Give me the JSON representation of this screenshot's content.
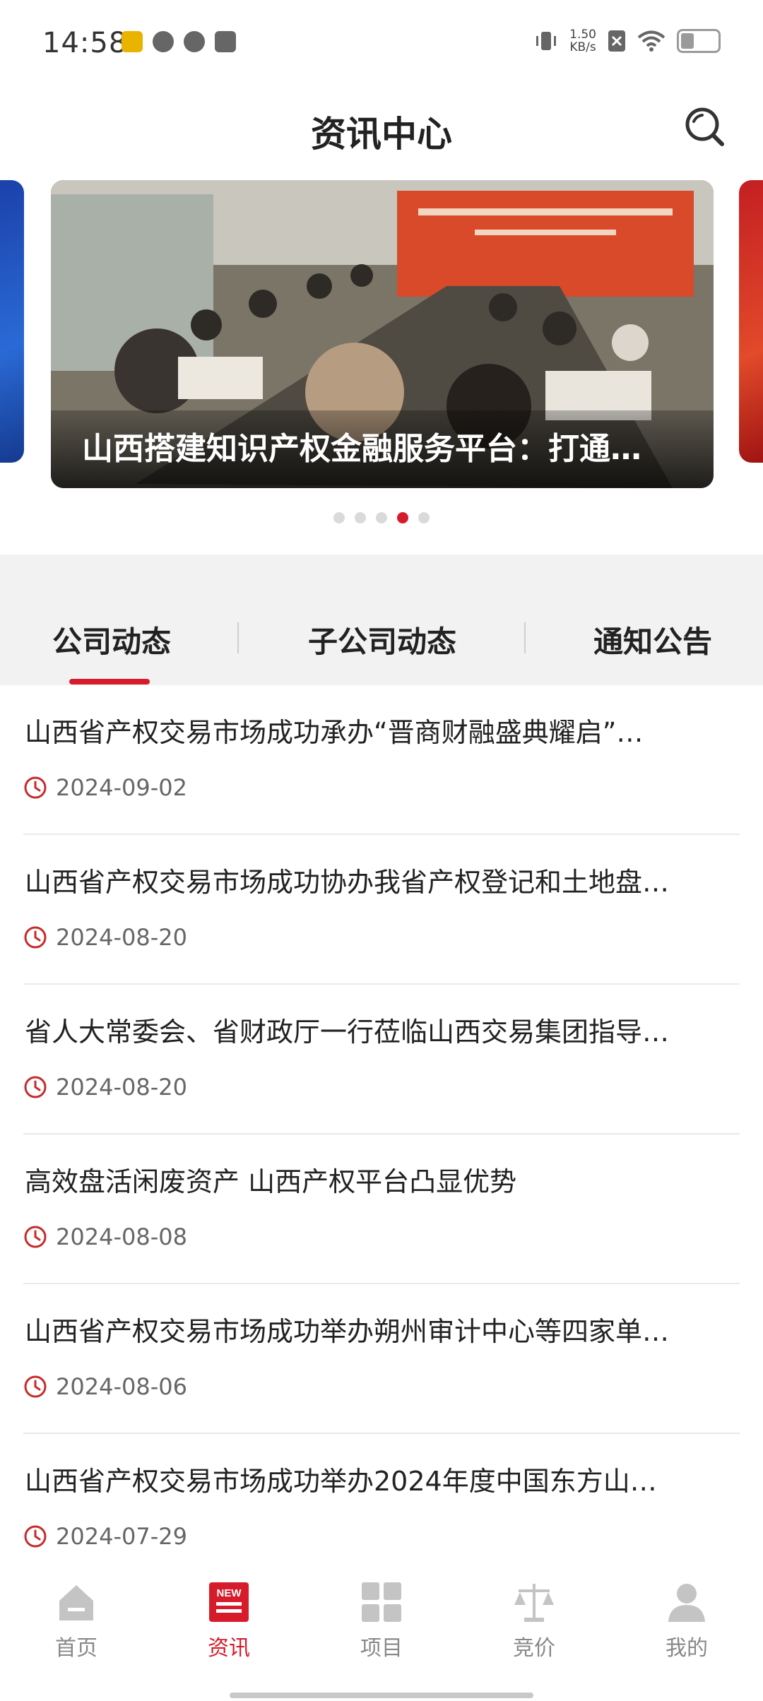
{
  "status_bar": {
    "time": "14:58",
    "net_speed_value": "1.50",
    "net_speed_unit": "KB/s"
  },
  "header": {
    "title": "资讯中心"
  },
  "carousel": {
    "caption": "山西搭建知识产权金融服务平台：打通…",
    "slide_count": 5,
    "active_index": 3
  },
  "tabs": [
    {
      "label": "公司动态",
      "active": true
    },
    {
      "label": "子公司动态",
      "active": false
    },
    {
      "label": "通知公告",
      "active": false
    }
  ],
  "news": [
    {
      "title": "山西省产权交易市场成功承办“晋商财融盛典耀启”…",
      "date": "2024-09-02"
    },
    {
      "title": "山西省产权交易市场成功协办我省产权登记和土地盘…",
      "date": "2024-08-20"
    },
    {
      "title": "省人大常委会、省财政厅一行莅临山西交易集团指导…",
      "date": "2024-08-20"
    },
    {
      "title": "高效盘活闲废资产  山西产权平台凸显优势",
      "date": "2024-08-08"
    },
    {
      "title": "山西省产权交易市场成功举办朔州审计中心等四家单…",
      "date": "2024-08-06"
    },
    {
      "title": "山西省产权交易市场成功举办2024年度中国东方山…",
      "date": "2024-07-29"
    }
  ],
  "bottom_nav": [
    {
      "label": "首页",
      "icon": "home-icon",
      "active": false
    },
    {
      "label": "资讯",
      "icon": "news-icon",
      "active": true,
      "badge": "NEW"
    },
    {
      "label": "项目",
      "icon": "grid-icon",
      "active": false
    },
    {
      "label": "竞价",
      "icon": "scale-icon",
      "active": false
    },
    {
      "label": "我的",
      "icon": "user-icon",
      "active": false
    }
  ],
  "colors": {
    "accent": "#d61b2a",
    "tab_bg": "#f2f2f2",
    "nav_inactive": "#aaaaaa"
  }
}
